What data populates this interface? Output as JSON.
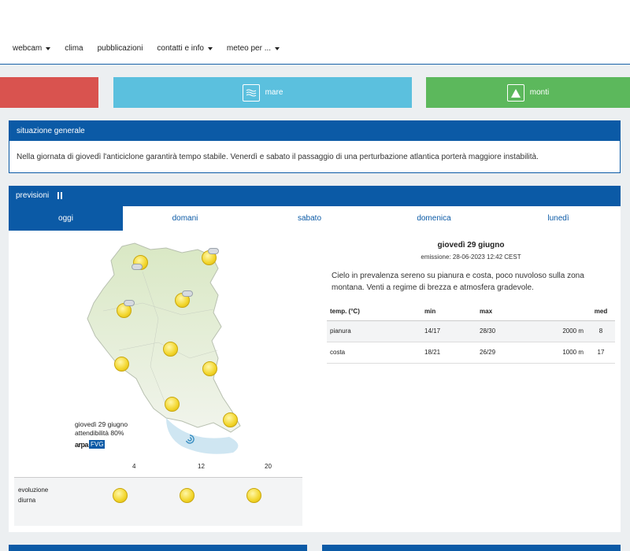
{
  "nav": {
    "items": [
      {
        "label": "webcam",
        "has_caret": true
      },
      {
        "label": "clima",
        "has_caret": false
      },
      {
        "label": "pubblicazioni",
        "has_caret": false
      },
      {
        "label": "contatti e info",
        "has_caret": true
      },
      {
        "label": "meteo per ...",
        "has_caret": true
      }
    ]
  },
  "tiles": {
    "sea_label": "mare",
    "sea_icon": "waves-icon",
    "mountain_label": "monti",
    "mountain_icon": "mountain-icon"
  },
  "situation": {
    "title": "situazione generale",
    "text": "Nella giornata di giovedì l'anticiclone garantirà tempo stabile. Venerdì e sabato il passaggio di una perturbazione atlantica porterà maggiore instabilità."
  },
  "forecast": {
    "title": "previsioni",
    "tabs": [
      "oggi",
      "domani",
      "sabato",
      "domenica",
      "lunedì"
    ],
    "active_tab": 0,
    "map_caption_date": "giovedì 29 giugno",
    "map_caption_reliability": "attendibilità 80%",
    "logo_text": "arpa",
    "logo_badge": "FVG",
    "hours": [
      "4",
      "12",
      "20"
    ],
    "evolution_label_1": "evoluzione",
    "evolution_label_2": "diurna",
    "detail": {
      "date": "giovedì 29 giugno",
      "emission": "emissione: 28-06-2023 12:42 CEST",
      "description": "Cielo in prevalenza sereno su pianura e costa, poco nuvoloso sulla zona montana. Venti a regime di brezza e atmosfera gradevole.",
      "table": {
        "headers": [
          "temp. (°C)",
          "min",
          "max",
          "",
          "med"
        ],
        "rows": [
          [
            "pianura",
            "14/17",
            "28/30",
            "2000 m",
            "8"
          ],
          [
            "costa",
            "18/21",
            "26/29",
            "1000 m",
            "17"
          ]
        ]
      }
    }
  },
  "colors": {
    "primary": "#0b5aa6",
    "red_tile": "#d9534f",
    "sea_tile": "#5bc0de",
    "mountain_tile": "#5cb85c"
  }
}
